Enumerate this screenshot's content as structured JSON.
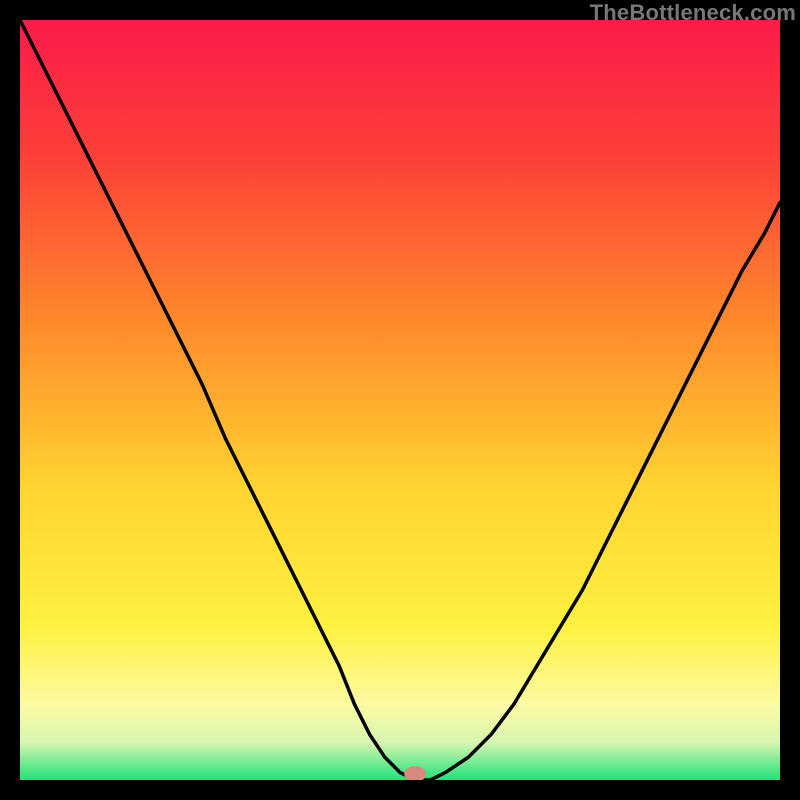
{
  "watermark": "TheBottleneck.com",
  "colors": {
    "black": "#000000",
    "curve": "#000000",
    "marker": "#d98a80",
    "gradient_top": "#fc1b4a",
    "gradient_mid_orange": "#ff7a33",
    "gradient_mid_yellow": "#ffe634",
    "gradient_pale_yellow": "#fcfab0",
    "gradient_bottom": "#1fe37a"
  },
  "chart_data": {
    "type": "line",
    "title": "",
    "xlabel": "",
    "ylabel": "",
    "xlim": [
      0,
      100
    ],
    "ylim": [
      0,
      100
    ],
    "x": [
      0,
      3,
      6,
      9,
      12,
      15,
      18,
      21,
      24,
      27,
      30,
      33,
      36,
      39,
      42,
      44,
      46,
      48,
      50,
      52,
      54,
      56,
      59,
      62,
      65,
      68,
      71,
      74,
      77,
      80,
      83,
      86,
      89,
      92,
      95,
      98,
      100
    ],
    "values": [
      100,
      94,
      88,
      82,
      76,
      70,
      64,
      58,
      52,
      45,
      39,
      33,
      27,
      21,
      15,
      10,
      6,
      3,
      1,
      0,
      0,
      1,
      3,
      6,
      10,
      15,
      20,
      25,
      31,
      37,
      43,
      49,
      55,
      61,
      67,
      72,
      76
    ],
    "marker": {
      "x": 52,
      "y": 0
    },
    "annotations": []
  }
}
